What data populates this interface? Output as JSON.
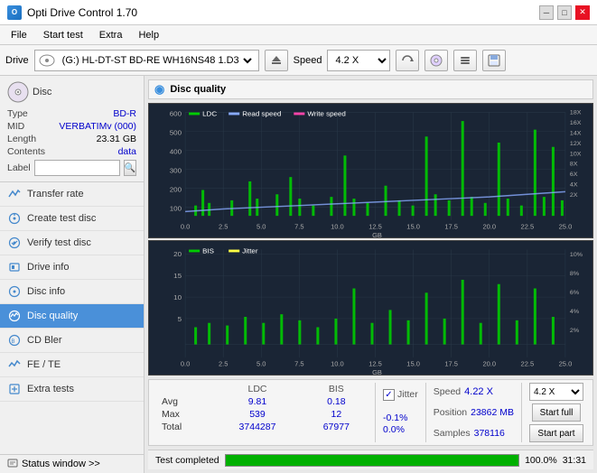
{
  "titleBar": {
    "title": "Opti Drive Control 1.70",
    "minBtn": "─",
    "maxBtn": "□",
    "closeBtn": "✕"
  },
  "menuBar": {
    "items": [
      "File",
      "Start test",
      "Extra",
      "Help"
    ]
  },
  "toolbar": {
    "driveLabel": "Drive",
    "driveValue": "(G:)  HL-DT-ST BD-RE  WH16NS48 1.D3",
    "speedLabel": "Speed",
    "speedValue": "4.2 X"
  },
  "sidebar": {
    "disc": {
      "type_label": "Type",
      "type_val": "BD-R",
      "mid_label": "MID",
      "mid_val": "VERBATIMv (000)",
      "length_label": "Length",
      "length_val": "23.31 GB",
      "contents_label": "Contents",
      "contents_val": "data",
      "label_label": "Label"
    },
    "navItems": [
      {
        "id": "transfer-rate",
        "label": "Transfer rate",
        "active": false
      },
      {
        "id": "create-test-disc",
        "label": "Create test disc",
        "active": false
      },
      {
        "id": "verify-test-disc",
        "label": "Verify test disc",
        "active": false
      },
      {
        "id": "drive-info",
        "label": "Drive info",
        "active": false
      },
      {
        "id": "disc-info",
        "label": "Disc info",
        "active": false
      },
      {
        "id": "disc-quality",
        "label": "Disc quality",
        "active": true
      },
      {
        "id": "cd-bler",
        "label": "CD Bler",
        "active": false
      },
      {
        "id": "fe-te",
        "label": "FE / TE",
        "active": false
      },
      {
        "id": "extra-tests",
        "label": "Extra tests",
        "active": false
      }
    ],
    "statusWindow": "Status window >>"
  },
  "content": {
    "title": "Disc quality",
    "chart1": {
      "legend": [
        {
          "label": "LDC",
          "color": "#00cc00"
        },
        {
          "label": "Read speed",
          "color": "#88aaff"
        },
        {
          "label": "Write speed",
          "color": "#ff44aa"
        }
      ],
      "yAxisLeft": [
        "600",
        "500",
        "400",
        "300",
        "200",
        "100"
      ],
      "yAxisRight": [
        "18X",
        "16X",
        "14X",
        "12X",
        "10X",
        "8X",
        "6X",
        "4X",
        "2X"
      ],
      "xAxis": [
        "0.0",
        "2.5",
        "5.0",
        "7.5",
        "10.0",
        "12.5",
        "15.0",
        "17.5",
        "20.0",
        "22.5",
        "25.0"
      ],
      "xLabel": "GB"
    },
    "chart2": {
      "legend": [
        {
          "label": "BIS",
          "color": "#00cc00"
        },
        {
          "label": "Jitter",
          "color": "#ffff00"
        }
      ],
      "yAxisLeft": [
        "20",
        "15",
        "10",
        "5"
      ],
      "yAxisRight": [
        "10%",
        "8%",
        "6%",
        "4%",
        "2%"
      ],
      "xAxis": [
        "0.0",
        "2.5",
        "5.0",
        "7.5",
        "10.0",
        "12.5",
        "15.0",
        "17.5",
        "20.0",
        "22.5",
        "25.0"
      ],
      "xLabel": "GB"
    },
    "stats": {
      "columns": [
        "LDC",
        "BIS",
        "",
        "Jitter",
        "Speed",
        "4.22 X"
      ],
      "rows": [
        {
          "label": "Avg",
          "ldc": "9.81",
          "bis": "0.18",
          "jitter": "-0.1%"
        },
        {
          "label": "Max",
          "ldc": "539",
          "bis": "12",
          "jitter": "0.0%"
        },
        {
          "label": "Total",
          "ldc": "3744287",
          "bis": "67977",
          "jitter": ""
        }
      ],
      "position_label": "Position",
      "position_val": "23862 MB",
      "samples_label": "Samples",
      "samples_val": "378116",
      "speedSelector": "4.2 X",
      "btn1": "Start full",
      "btn2": "Start part"
    }
  },
  "progressBar": {
    "percent": 100,
    "percentLabel": "100.0%",
    "time": "31:31"
  },
  "statusText": "Test completed"
}
